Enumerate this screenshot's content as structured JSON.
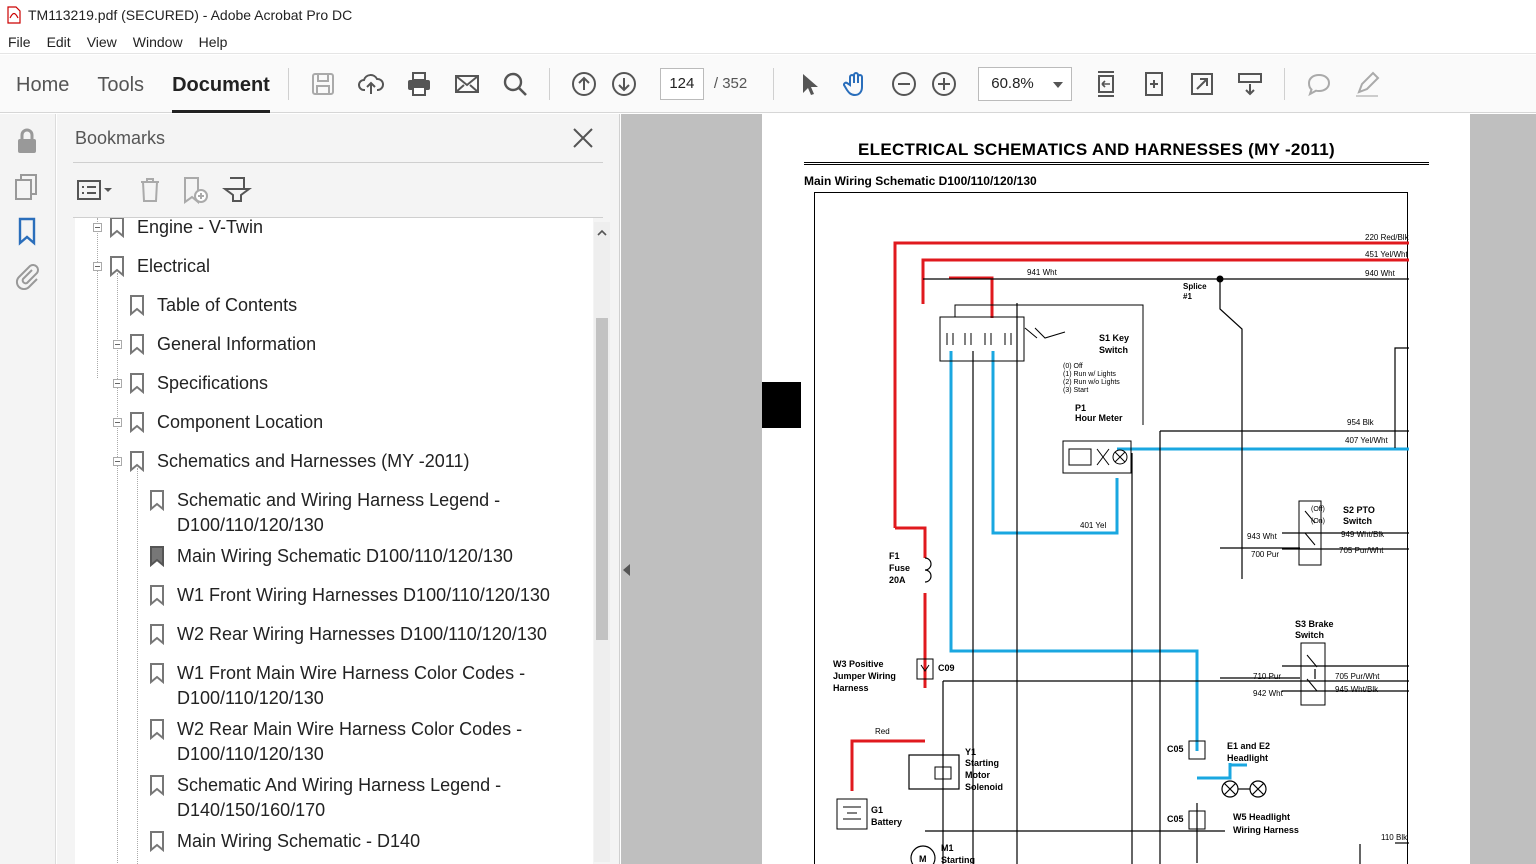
{
  "window": {
    "title": "TM113219.pdf (SECURED) - Adobe Acrobat Pro DC"
  },
  "menu": [
    "File",
    "Edit",
    "View",
    "Window",
    "Help"
  ],
  "toolbar": {
    "tabs": [
      "Home",
      "Tools",
      "Document"
    ],
    "active_tab": "Document",
    "page_current": "124",
    "page_total": "/ 352",
    "zoom": "60.8%"
  },
  "bookmarks_panel": {
    "title": "Bookmarks",
    "items": [
      {
        "label": "Engine - V-Twin",
        "level": 1
      },
      {
        "label": "Electrical",
        "level": 1
      },
      {
        "label": "Table of Contents",
        "level": 2
      },
      {
        "label": "General Information",
        "level": 2
      },
      {
        "label": "Specifications",
        "level": 2
      },
      {
        "label": "Component Location",
        "level": 2
      },
      {
        "label": "Schematics and Harnesses (MY -2011)",
        "level": 2
      },
      {
        "label": "Schematic and Wiring Harness Legend -",
        "label2": "D100/110/120/130",
        "level": 3
      },
      {
        "label": "Main Wiring Schematic D100/110/120/130",
        "level": 3,
        "selected": true
      },
      {
        "label": "W1 Front Wiring Harnesses D100/110/120/130",
        "level": 3
      },
      {
        "label": "W2 Rear Wiring Harnesses D100/110/120/130",
        "level": 3
      },
      {
        "label": "W1 Front Main Wire Harness Color Codes -",
        "label2": "D100/110/120/130",
        "level": 3
      },
      {
        "label": "W2 Rear Main Wire Harness Color Codes -",
        "label2": "D100/110/120/130",
        "level": 3
      },
      {
        "label": "Schematic And Wiring Harness Legend -",
        "label2": "D140/150/160/170",
        "level": 3
      },
      {
        "label": "Main Wiring Schematic - D140",
        "level": 3
      }
    ]
  },
  "document": {
    "header": "ELECTRICAL   SCHEMATICS AND HARNESSES (MY -2011)",
    "subheader": "Main Wiring Schematic D100/110/120/130",
    "labels": {
      "w220": "220 Red/Blk",
      "w451": "451 Yel/Wht",
      "w941": "941 Wht",
      "w940": "940 Wht",
      "splice": "Splice",
      "splice_num": "#1",
      "s1": "S1 Key",
      "s1b": "Switch",
      "key_off": "(0) Off",
      "key_run_l": "(1) Run w/ Lights",
      "key_run_wl": "(2) Run w/o Lights",
      "key_start": "(3) Start",
      "p1": "P1",
      "p1b": "Hour Meter",
      "w954": "954 Blk",
      "w407": "407 Yel/Wht",
      "f1": "F1",
      "f1b": "Fuse",
      "f1c": "20A",
      "s2": "S2 PTO",
      "s2b": "Switch",
      "s2_off": "(Off)",
      "s2_on": "(On)",
      "w943": "943 Wht",
      "w949": "949 Wht/Blk",
      "w700": "700 Pur",
      "w705": "705 Pur/Wht",
      "s3": "S3 Brake",
      "s3b": "Switch",
      "w710": "710 Pur",
      "w705b": "705 Pur/Wht",
      "w942": "942 Wht",
      "w945": "945 Wht/Blk",
      "w3": "W3 Positive",
      "w3b": "Jumper Wiring",
      "w3c": "Harness",
      "c09": "C09",
      "c05": "C05",
      "c05b": "C05",
      "y1": "Y1",
      "y1b": "Starting",
      "y1c": "Motor",
      "y1d": "Solenoid",
      "g1": "G1",
      "g1b": "Battery",
      "e1": "E1 and E2",
      "e1b": "Headlight",
      "w5": "W5 Headlight",
      "w5b": "Wiring Harness",
      "m1": "M1",
      "m1b": "Starting",
      "w110": "110 Blk",
      "w401": "401 Yel",
      "red": "Red"
    }
  },
  "colors": {
    "red_wire": "#e0191e",
    "blue_wire": "#1aa7e0",
    "accent": "#2a6ebb"
  }
}
